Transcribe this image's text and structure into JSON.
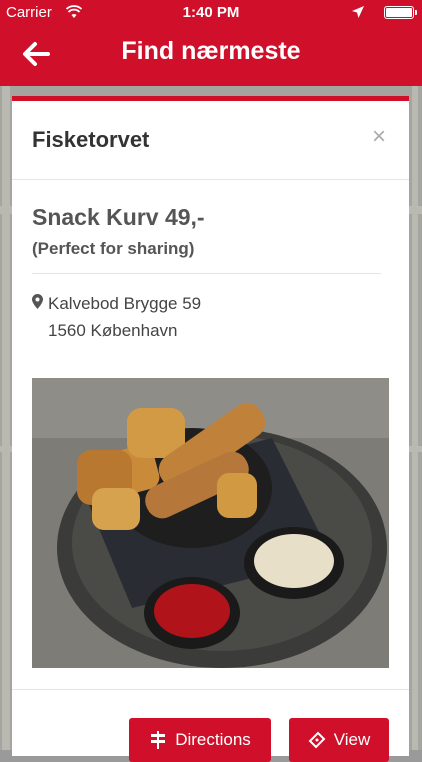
{
  "status_bar": {
    "carrier": "Carrier",
    "time": "1:40 PM"
  },
  "nav": {
    "title": "Find nærmeste"
  },
  "modal": {
    "title": "Fisketorvet",
    "close_label": "×",
    "offer_title": "Snack Kurv 49,-",
    "offer_subtitle": "(Perfect for sharing)",
    "address_line1": "Kalvebod Brygge 59",
    "address_line2": "1560 København",
    "buttons": {
      "directions": "Directions",
      "view": "View"
    }
  },
  "colors": {
    "brand": "#d0102a"
  },
  "icons": [
    "wifi-icon",
    "location-arrow-icon",
    "battery-icon",
    "back-arrow-icon",
    "close-icon",
    "map-pin-icon",
    "directions-signpost-icon",
    "ticket-icon"
  ]
}
